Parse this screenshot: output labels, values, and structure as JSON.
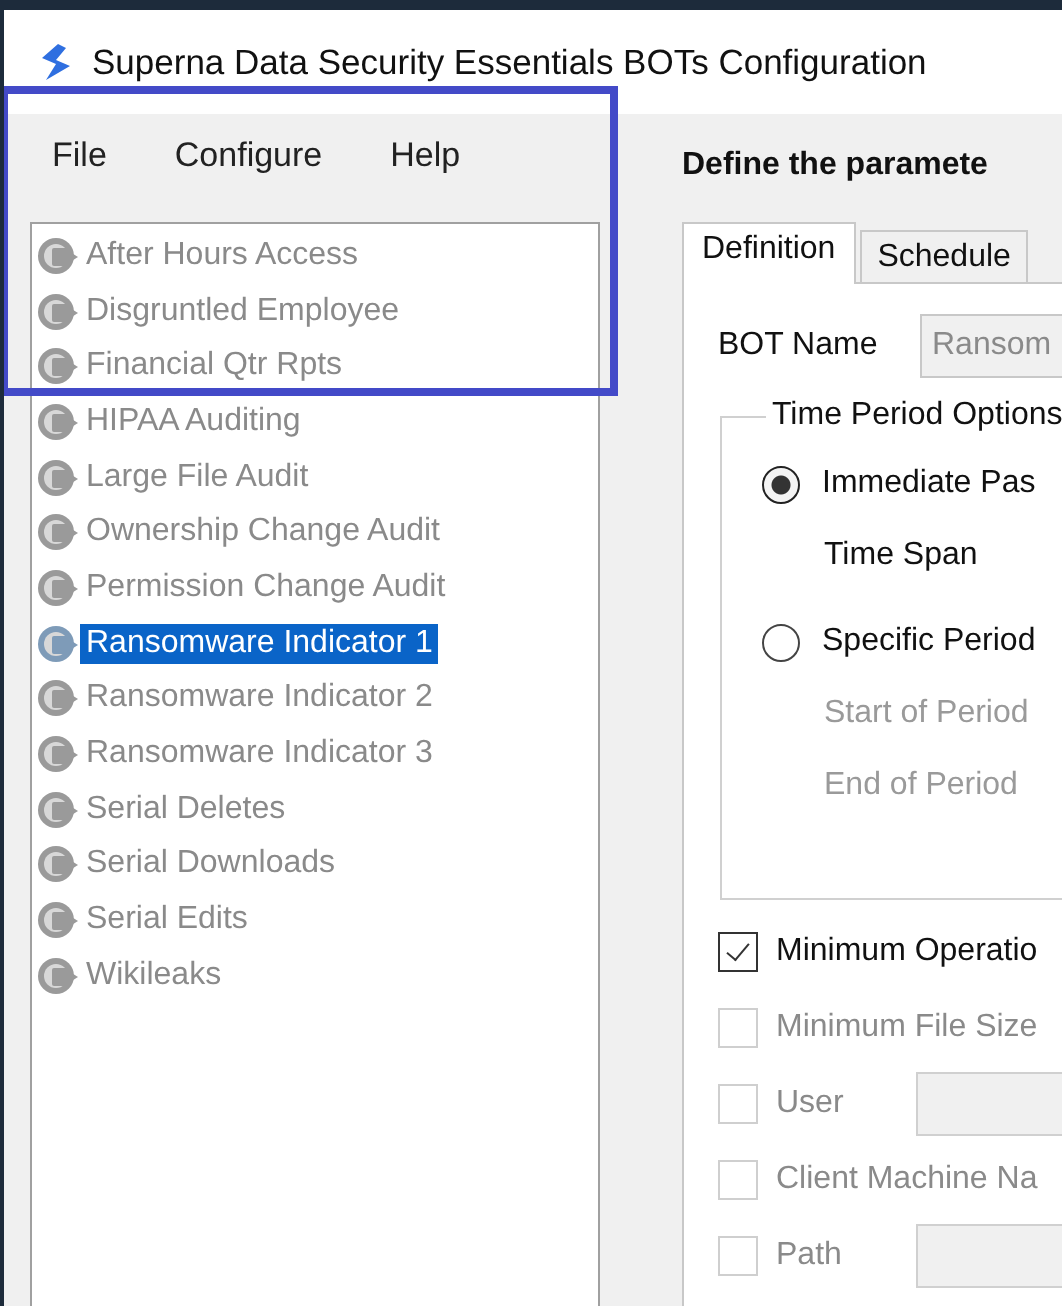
{
  "window": {
    "title": "Superna Data Security Essentials BOTs Configuration"
  },
  "menu": [
    "File",
    "Configure",
    "Help"
  ],
  "bots": [
    {
      "label": "After Hours Access",
      "selected": false
    },
    {
      "label": "Disgruntled Employee",
      "selected": false
    },
    {
      "label": "Financial Qtr Rpts",
      "selected": false
    },
    {
      "label": "HIPAA Auditing",
      "selected": false
    },
    {
      "label": "Large File Audit",
      "selected": false
    },
    {
      "label": "Ownership Change Audit",
      "selected": false
    },
    {
      "label": "Permission Change Audit",
      "selected": false
    },
    {
      "label": "Ransomware Indicator 1",
      "selected": true
    },
    {
      "label": "Ransomware Indicator 2",
      "selected": false
    },
    {
      "label": "Ransomware Indicator 3",
      "selected": false
    },
    {
      "label": "Serial Deletes",
      "selected": false
    },
    {
      "label": "Serial Downloads",
      "selected": false
    },
    {
      "label": "Serial Edits",
      "selected": false
    },
    {
      "label": "Wikileaks",
      "selected": false
    }
  ],
  "heading": "Define the paramete",
  "tabs": [
    {
      "label": "Definition",
      "selected": true
    },
    {
      "label": "Schedule",
      "selected": false
    }
  ],
  "bot_name": {
    "label": "BOT Name",
    "value": "Ransom"
  },
  "time_period": {
    "title": "Time Period Options",
    "rows": [
      {
        "kind": "radio",
        "label": "Immediate Pas",
        "selected": true
      },
      {
        "kind": "label",
        "label": "Time Span",
        "disabled": false
      },
      {
        "kind": "radio",
        "label": "Specific Period",
        "selected": false
      },
      {
        "kind": "label",
        "label": "Start of Period",
        "disabled": true
      },
      {
        "kind": "label",
        "label": "End of Period",
        "disabled": true
      }
    ]
  },
  "filters": [
    {
      "label": "Minimum Operatio",
      "checked": true,
      "disabled": false,
      "has_field": false
    },
    {
      "label": "Minimum File Size",
      "checked": false,
      "disabled": true,
      "has_field": false
    },
    {
      "label": "User",
      "checked": false,
      "disabled": true,
      "has_field": true
    },
    {
      "label": "Client Machine Na",
      "checked": false,
      "disabled": true,
      "has_field": false
    },
    {
      "label": "Path",
      "checked": false,
      "disabled": true,
      "has_field": true
    }
  ]
}
